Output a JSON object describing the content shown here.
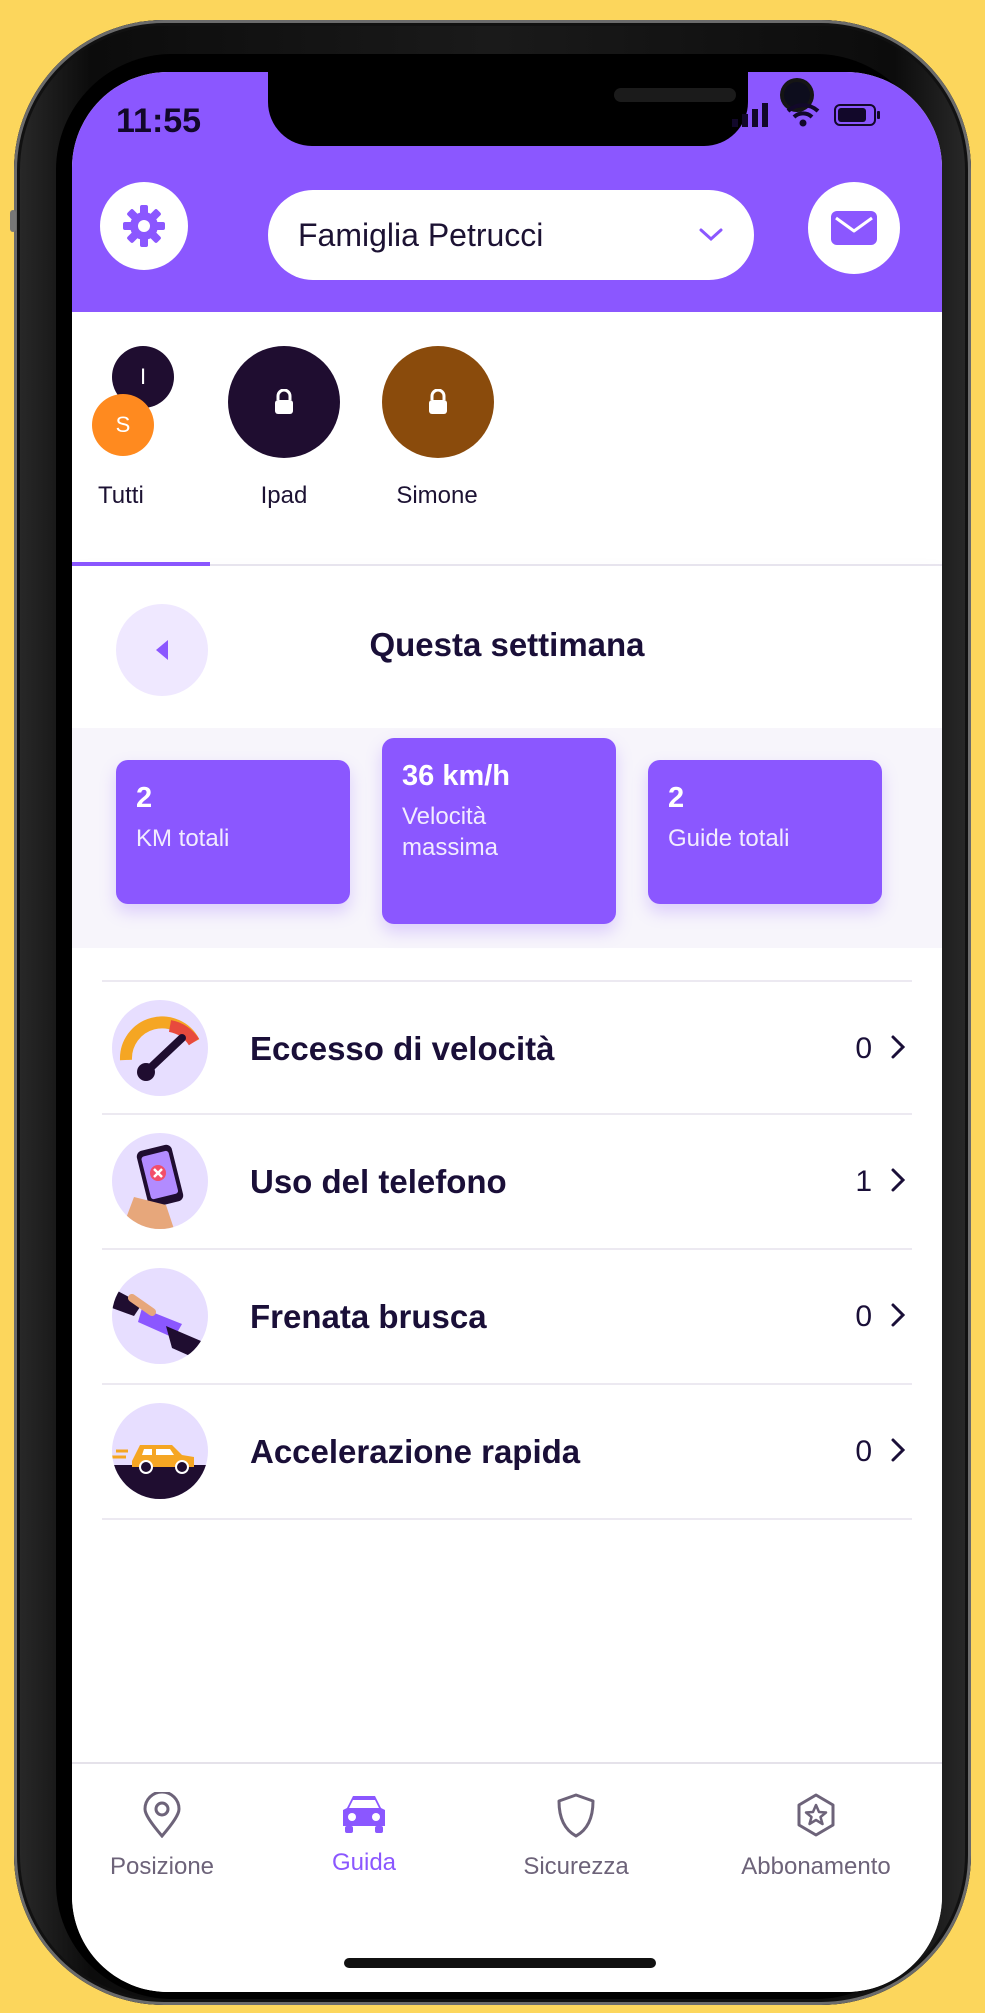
{
  "status_bar": {
    "time": "11:55"
  },
  "header": {
    "family_name": "Famiglia Petrucci"
  },
  "members": [
    {
      "label": "Tutti",
      "avatar_letters": [
        "I",
        "S"
      ]
    },
    {
      "label": "Ipad"
    },
    {
      "label": "Simone"
    }
  ],
  "period": {
    "title": "Questa settimana"
  },
  "stats": [
    {
      "value": "2",
      "label": "KM totali"
    },
    {
      "value": "36 km/h",
      "label": "Velocità massima"
    },
    {
      "value": "2",
      "label": "Guide totali"
    }
  ],
  "events": [
    {
      "name": "Eccesso di velocità",
      "count": "0",
      "icon": "speedometer-icon"
    },
    {
      "name": "Uso del telefono",
      "count": "1",
      "icon": "phone-use-icon"
    },
    {
      "name": "Frenata brusca",
      "count": "0",
      "icon": "brake-icon"
    },
    {
      "name": "Accelerazione rapida",
      "count": "0",
      "icon": "fast-car-icon"
    }
  ],
  "nav": [
    {
      "label": "Posizione",
      "icon": "location-pin-icon"
    },
    {
      "label": "Guida",
      "icon": "car-icon",
      "active": true
    },
    {
      "label": "Sicurezza",
      "icon": "shield-icon"
    },
    {
      "label": "Abbonamento",
      "icon": "star-badge-icon"
    }
  ],
  "colors": {
    "accent": "#8B57FF",
    "background": "#FCD65C",
    "text_dark": "#1a0f38",
    "orange_avatar": "#FF8A1F",
    "brown_avatar": "#8A4B0C",
    "dark_avatar": "#1F0D30"
  }
}
